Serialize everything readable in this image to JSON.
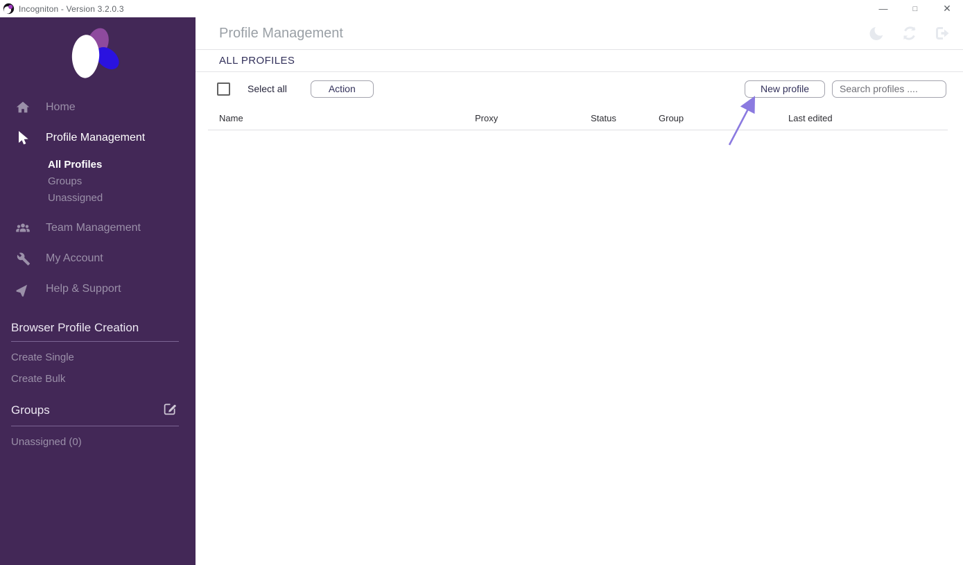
{
  "window": {
    "title": "Incogniton - Version 3.2.0.3",
    "controls": {
      "minimize": "—",
      "maximize": "□",
      "close": "✕"
    }
  },
  "sidebar": {
    "nav": [
      {
        "label": "Home",
        "icon": "home-icon",
        "active": false
      },
      {
        "label": "Profile Management",
        "icon": "cursor-icon",
        "active": true
      },
      {
        "label": "Team Management",
        "icon": "team-icon",
        "active": false
      },
      {
        "label": "My Account",
        "icon": "wrench-icon",
        "active": false
      },
      {
        "label": "Help & Support",
        "icon": "send-icon",
        "active": false
      }
    ],
    "profile_sub": [
      {
        "label": "All Profiles",
        "active": true
      },
      {
        "label": "Groups",
        "active": false
      },
      {
        "label": "Unassigned",
        "active": false
      }
    ],
    "sections": [
      {
        "title": "Browser Profile Creation",
        "items": [
          "Create Single",
          "Create Bulk"
        ]
      },
      {
        "title": "Groups",
        "items": [
          "Unassigned (0)"
        ]
      }
    ]
  },
  "header": {
    "title": "Profile Management",
    "icons": [
      "moon-icon",
      "refresh-icon",
      "logout-icon"
    ]
  },
  "main": {
    "section_title": "ALL PROFILES",
    "toolbar": {
      "select_all_label": "Select all",
      "action_button": "Action",
      "new_profile_button": "New profile",
      "search_placeholder": "Search profiles ...."
    },
    "table": {
      "columns": [
        "Name",
        "Proxy",
        "Status",
        "Group",
        "Last edited"
      ],
      "rows": []
    },
    "annotation": {
      "type": "arrow",
      "points_to": "new-profile-button",
      "color": "#8b7ae0"
    }
  },
  "colors": {
    "sidebar_bg": "#432857",
    "sidebar_muted": "#9b90a9",
    "accent_dark": "#32305a",
    "logo_purple": "#8e4a9e",
    "logo_blue": "#2a12e0",
    "arrow": "#8b7ae0"
  }
}
